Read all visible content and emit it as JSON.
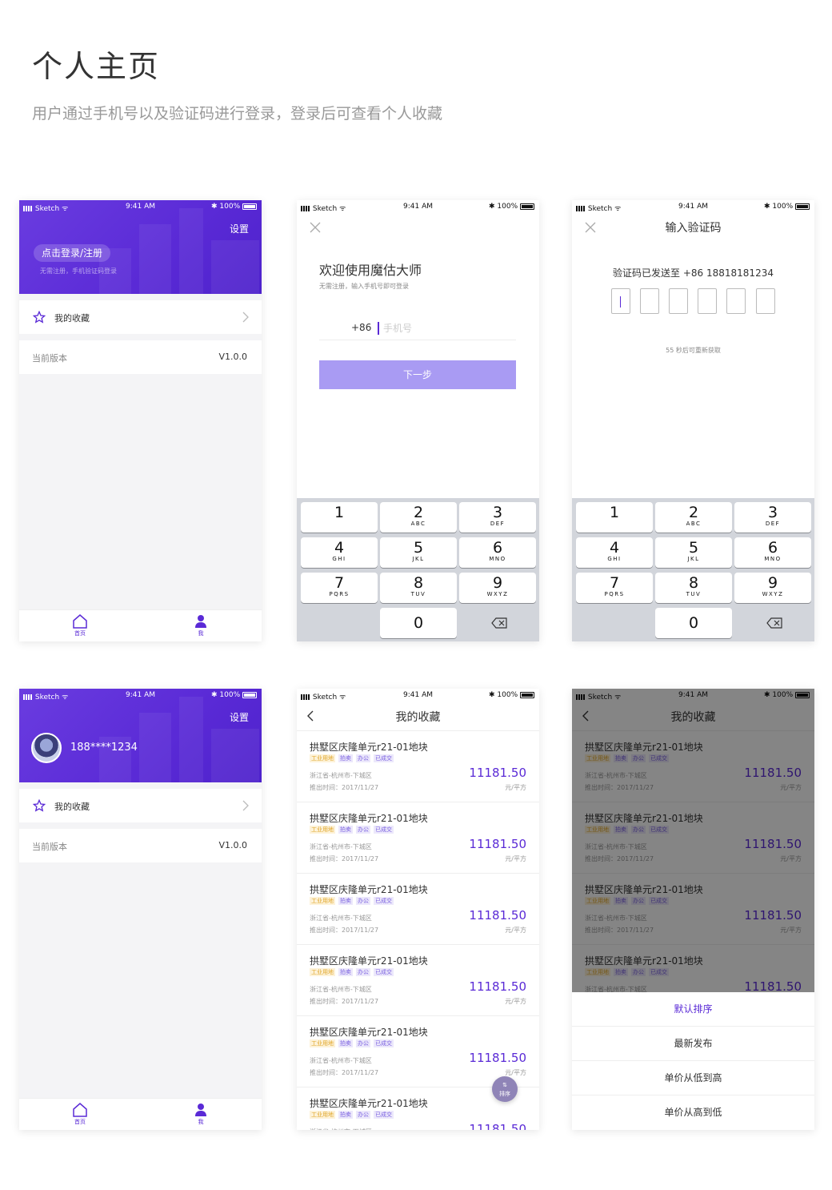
{
  "title": "个人主页",
  "subtitle": "用户通过手机号以及验证码进行登录，登录后可查看个人收藏",
  "status_bar": {
    "carrier": "Sketch",
    "time": "9:41 AM",
    "battery": "100%"
  },
  "profile": {
    "settings": "设置",
    "login_button": "点击登录/注册",
    "login_hint": "无需注册，手机验证码登录",
    "user_phone": "188****1234",
    "favorites_label": "我的收藏",
    "version_label": "当前版本",
    "version_value": "V1.0.0",
    "tab_home": "首页",
    "tab_me": "我"
  },
  "login": {
    "welcome": "欢迎使用魔估大师",
    "welcome_sub": "无需注册，输入手机号即可登录",
    "country_code": "+86",
    "phone_placeholder": "手机号",
    "next_button": "下一步"
  },
  "keypad": {
    "keys": [
      {
        "n": "1",
        "l": ""
      },
      {
        "n": "2",
        "l": "ABC"
      },
      {
        "n": "3",
        "l": "DEF"
      },
      {
        "n": "4",
        "l": "GHI"
      },
      {
        "n": "5",
        "l": "JKL"
      },
      {
        "n": "6",
        "l": "MNO"
      },
      {
        "n": "7",
        "l": "PQRS"
      },
      {
        "n": "8",
        "l": "TUV"
      },
      {
        "n": "9",
        "l": "WXYZ"
      },
      {
        "n": "0",
        "l": ""
      }
    ]
  },
  "verify": {
    "title": "输入验证码",
    "sent_text": "验证码已发送至 +86 18818181234",
    "resend": "55  秒后可重新获取"
  },
  "favorites": {
    "title": "我的收藏",
    "item_title": "拱墅区庆隆单元r21-01地块",
    "tags": [
      "工业用地",
      "拍卖",
      "办公",
      "已成交"
    ],
    "address": "浙江省-杭州市-下城区",
    "date": "推出时间：2017/11/27",
    "price": "11181.50",
    "unit": "元/平方",
    "sort_fab": "排序"
  },
  "sort_sheet": {
    "options": [
      "默认排序",
      "最新发布",
      "单价从低到高",
      "单价从高到低"
    ]
  },
  "colors": {
    "brand": "#5a2ad6",
    "button_disabled": "#a99bf3",
    "tag_yellow": "#e0a62a",
    "tag_purple": "#7b62e0"
  }
}
